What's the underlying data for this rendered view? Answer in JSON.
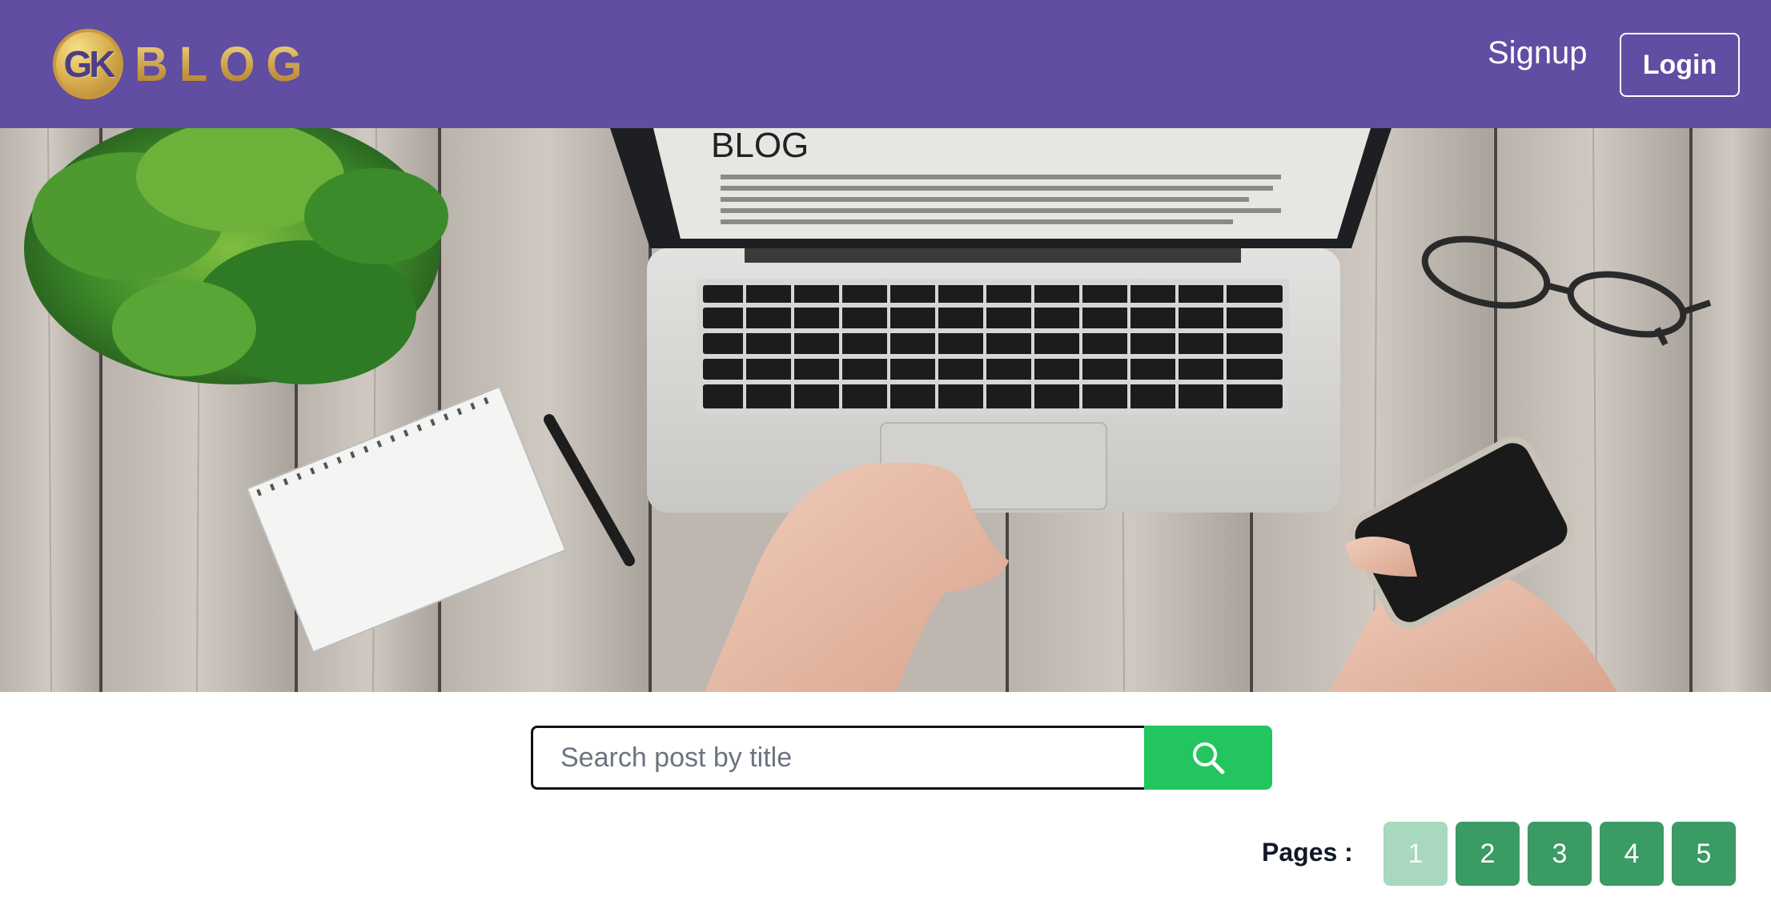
{
  "header": {
    "logo_badge": "GK",
    "logo_text": "BLOG",
    "signup_label": "Signup",
    "login_label": "Login"
  },
  "hero": {
    "screen_title": "BLOG",
    "image_icon": "desk-laptop-photo"
  },
  "search": {
    "placeholder": "Search post by title",
    "value": "",
    "button_icon": "search-icon"
  },
  "pagination": {
    "label": "Pages :",
    "pages": [
      "1",
      "2",
      "3",
      "4",
      "5"
    ],
    "current": 1
  },
  "colors": {
    "navbar": "#614da1",
    "search_button": "#22c55e",
    "page_button": "#3a9b64",
    "page_button_active": "#a8d8bd"
  }
}
